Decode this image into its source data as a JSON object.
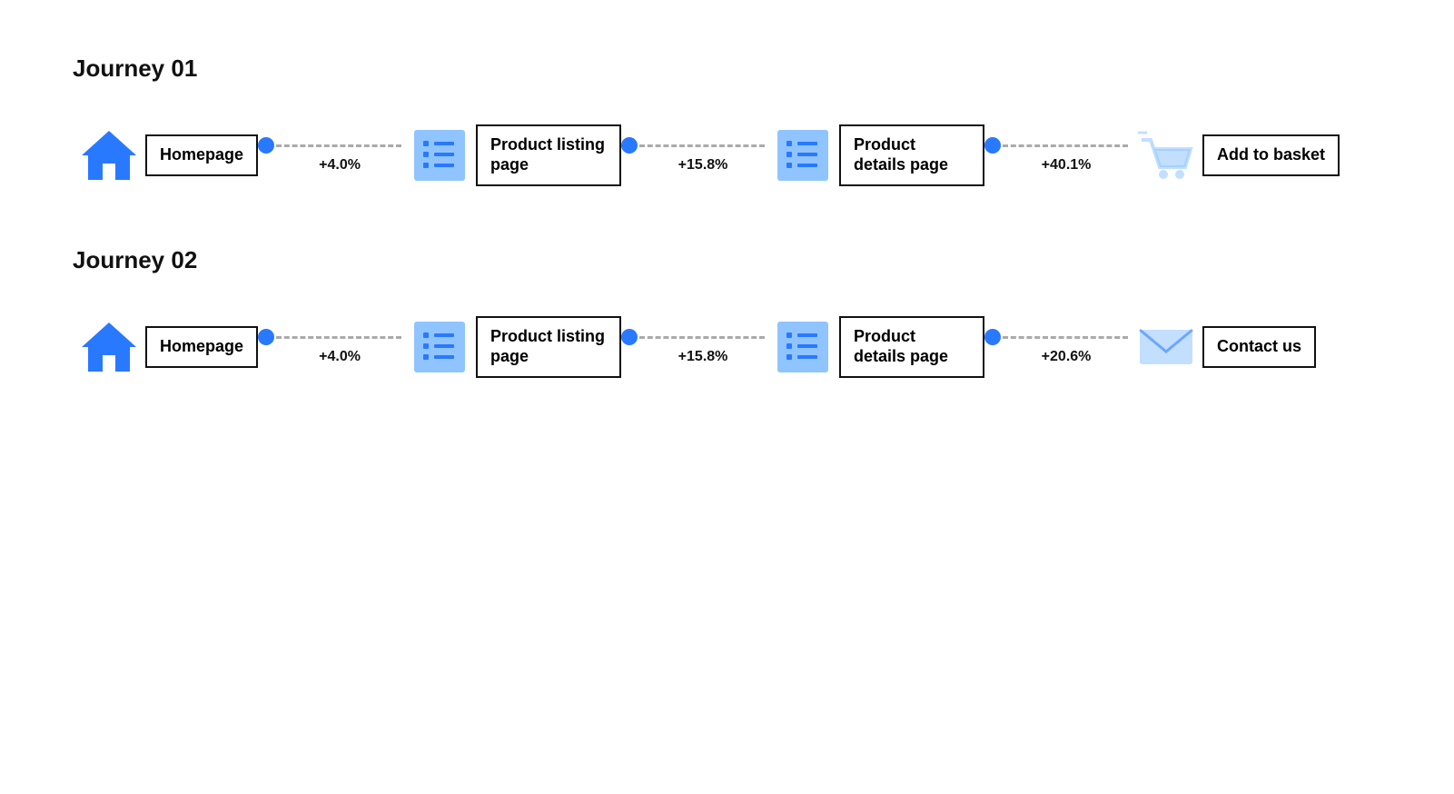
{
  "journeys": [
    {
      "id": "journey-01",
      "title": "Journey 01",
      "nodes": [
        {
          "id": "homepage-1",
          "type": "home",
          "label": "Homepage"
        },
        {
          "id": "listing-1",
          "type": "listing",
          "label": "Product listing page"
        },
        {
          "id": "details-1",
          "type": "details",
          "label": "Product details page"
        },
        {
          "id": "basket-1",
          "type": "basket",
          "label": "Add to basket"
        }
      ],
      "connectors": [
        {
          "id": "c1-1",
          "pct": "+4.0%"
        },
        {
          "id": "c1-2",
          "pct": "+15.8%"
        },
        {
          "id": "c1-3",
          "pct": "+40.1%"
        }
      ]
    },
    {
      "id": "journey-02",
      "title": "Journey 02",
      "nodes": [
        {
          "id": "homepage-2",
          "type": "home",
          "label": "Homepage"
        },
        {
          "id": "listing-2",
          "type": "listing",
          "label": "Product listing page"
        },
        {
          "id": "details-2",
          "type": "details",
          "label": "Product details page"
        },
        {
          "id": "contact-2",
          "type": "contact",
          "label": "Contact us"
        }
      ],
      "connectors": [
        {
          "id": "c2-1",
          "pct": "+4.0%"
        },
        {
          "id": "c2-2",
          "pct": "+15.8%"
        },
        {
          "id": "c2-3",
          "pct": "+20.6%"
        }
      ]
    }
  ]
}
